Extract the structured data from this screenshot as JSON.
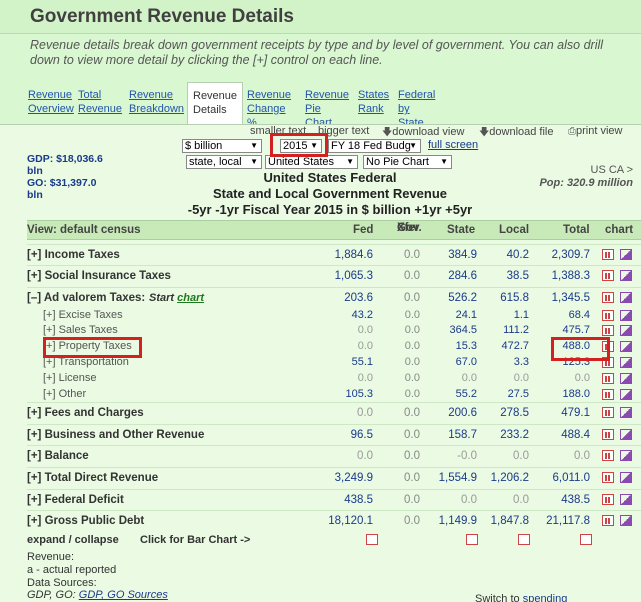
{
  "page": {
    "title": "Government Revenue Details",
    "description": "Revenue details break down government receipts by type and by level of government. You can also drill down to view more detail by clicking the [+] control on each line."
  },
  "tabs": [
    {
      "l1": "Revenue",
      "l2": "Overview"
    },
    {
      "l1": "Total",
      "l2": "Revenue"
    },
    {
      "l1": "Revenue",
      "l2": "Breakdown"
    },
    {
      "l1": "Revenue",
      "l2": "Details"
    },
    {
      "l1": "Revenue",
      "l2": "Change %"
    },
    {
      "l1": "Revenue",
      "l2": "Pie Chart"
    },
    {
      "l1": "States",
      "l2": "Rank"
    },
    {
      "l1": "Federal",
      "l2": "by State"
    }
  ],
  "controls": {
    "unit": "$ billion",
    "year": "2015",
    "budget": "FY 18 Fed Budg",
    "level": "state, local",
    "geo": "United States",
    "pie": "No Pie Chart",
    "smaller_text": "smaller text",
    "bigger_text": "bigger text",
    "download_view": "download view",
    "download_file": "download file",
    "print_view": "print view",
    "full_screen": "full screen"
  },
  "left_info": {
    "gdp": "GDP: $18,036.6 bln",
    "go": "GO: $31,397.0 bln"
  },
  "center": {
    "line1": "United States Federal",
    "line2": "State and Local Government Revenue",
    "line3": "-5yr -1yr  Fiscal Year 2015 in $ billion  +1yr +5yr"
  },
  "right_info": {
    "geo": "US CA >",
    "pop": "Pop: 320.9 million"
  },
  "table": {
    "headers": {
      "view": "View: default census",
      "fed": "Fed",
      "gov1": "Gov.",
      "gov2": "Xfer",
      "state": "State",
      "local": "Local",
      "total": "Total",
      "chart": "chart"
    },
    "rows": [
      {
        "kind": "main",
        "label": "[+] Income Taxes",
        "fed": "1,884.6",
        "gov": "0.0",
        "state": "384.9",
        "local": "40.2",
        "total": "2,309.7"
      },
      {
        "kind": "main",
        "label": "[+] Social Insurance Taxes",
        "fed": "1,065.3",
        "gov": "0.0",
        "state": "284.6",
        "local": "38.5",
        "total": "1,388.3"
      },
      {
        "kind": "main",
        "label": "[–] Ad valorem Taxes:",
        "start": "Start",
        "chart_link": "chart",
        "fed": "203.6",
        "gov": "0.0",
        "state": "526.2",
        "local": "615.8",
        "total": "1,345.5"
      },
      {
        "kind": "sub",
        "label": "[+] Excise Taxes",
        "fed": "43.2",
        "gov": "0.0",
        "state": "24.1",
        "local": "1.1",
        "total": "68.4"
      },
      {
        "kind": "sub",
        "label": "[+] Sales Taxes",
        "fed": "0.0",
        "gov": "0.0",
        "state": "364.5",
        "local": "111.2",
        "total": "475.7"
      },
      {
        "kind": "sub",
        "label": "[+] Property Taxes",
        "fed": "0.0",
        "gov": "0.0",
        "state": "15.3",
        "local": "472.7",
        "total": "488.0"
      },
      {
        "kind": "sub",
        "label": "[+] Transportation",
        "fed": "55.1",
        "gov": "0.0",
        "state": "67.0",
        "local": "3.3",
        "total": "125.3"
      },
      {
        "kind": "sub",
        "label": "[+] License",
        "fed": "0.0",
        "gov": "0.0",
        "state": "0.0",
        "local": "0.0",
        "total": "0.0"
      },
      {
        "kind": "sub",
        "label": "[+] Other",
        "fed": "105.3",
        "gov": "0.0",
        "state": "55.2",
        "local": "27.5",
        "total": "188.0"
      },
      {
        "kind": "main",
        "label": "[+] Fees and Charges",
        "fed": "0.0",
        "gov": "0.0",
        "state": "200.6",
        "local": "278.5",
        "total": "479.1"
      },
      {
        "kind": "main",
        "label": "[+] Business and Other Revenue",
        "fed": "96.5",
        "gov": "0.0",
        "state": "158.7",
        "local": "233.2",
        "total": "488.4"
      },
      {
        "kind": "main",
        "label": "[+] Balance",
        "fed": "0.0",
        "gov": "0.0",
        "state": "-0.0",
        "local": "0.0",
        "total": "0.0"
      },
      {
        "kind": "main",
        "label": "[+] Total Direct Revenue",
        "fed": "3,249.9",
        "gov": "0.0",
        "state": "1,554.9",
        "local": "1,206.2",
        "total": "6,011.0"
      },
      {
        "kind": "main",
        "label": "[+] Federal Deficit",
        "fed": "438.5",
        "gov": "0.0",
        "state": "0.0",
        "local": "0.0",
        "total": "438.5"
      },
      {
        "kind": "main",
        "label": "[+] Gross Public Debt",
        "fed": "18,120.1",
        "gov": "0.0",
        "state": "1,149.9",
        "local": "1,847.8",
        "total": "21,117.8"
      }
    ]
  },
  "footer": {
    "expand": "expand / collapse",
    "bar_chart": "Click for Bar Chart ->",
    "revenue": "Revenue:",
    "actual": "a - actual reported",
    "sources": "Data Sources:",
    "gdp_go": "GDP, GO:",
    "gdp_go_link": "GDP, GO Sources",
    "switch": "Switch to",
    "spending": "spending"
  },
  "colors": {
    "background": "#d9f7d0",
    "highlight": "#d32020",
    "link": "#1a3a8a"
  }
}
